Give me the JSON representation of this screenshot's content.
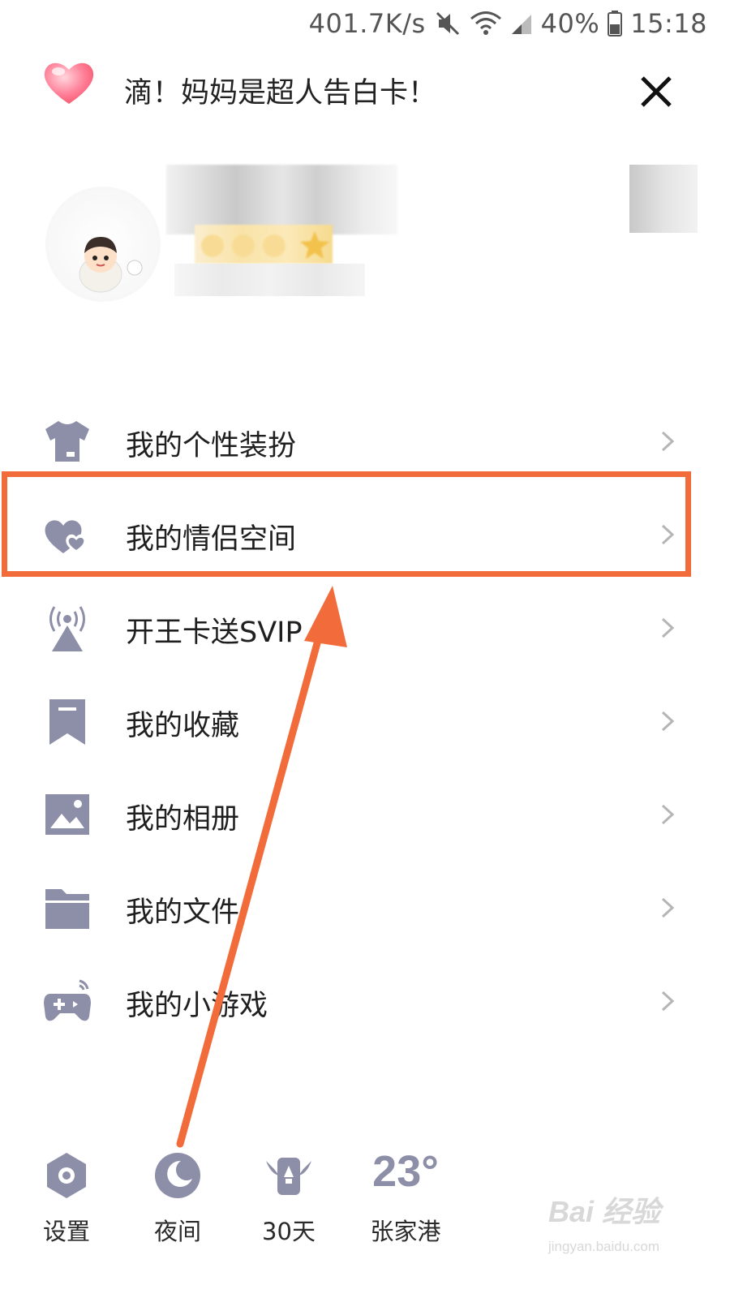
{
  "status_bar": {
    "speed": "401.7K/s",
    "battery": "40%",
    "time": "15:18"
  },
  "header": {
    "title": "滴！妈妈是超人告白卡！"
  },
  "menu": {
    "items": [
      {
        "label": "我的个性装扮",
        "icon": "tshirt-icon"
      },
      {
        "label": "我的情侣空间",
        "icon": "couple-heart-icon"
      },
      {
        "label": "开王卡送SVIP",
        "icon": "signal-tower-icon"
      },
      {
        "label": "我的收藏",
        "icon": "bookmark-icon"
      },
      {
        "label": "我的相册",
        "icon": "image-icon"
      },
      {
        "label": "我的文件",
        "icon": "folder-icon"
      },
      {
        "label": "我的小游戏",
        "icon": "gamepad-icon"
      }
    ]
  },
  "bottom_bar": {
    "settings_label": "设置",
    "night_label": "夜间",
    "days_label": "30天",
    "weather_temp": "23°",
    "weather_city": "张家港"
  },
  "watermark": {
    "text": "Bai 经验",
    "url": "jingyan.baidu.com"
  },
  "colors": {
    "icon": "#8d8fa8",
    "highlight": "#f26b3a",
    "chevron": "#b5b5b5"
  }
}
